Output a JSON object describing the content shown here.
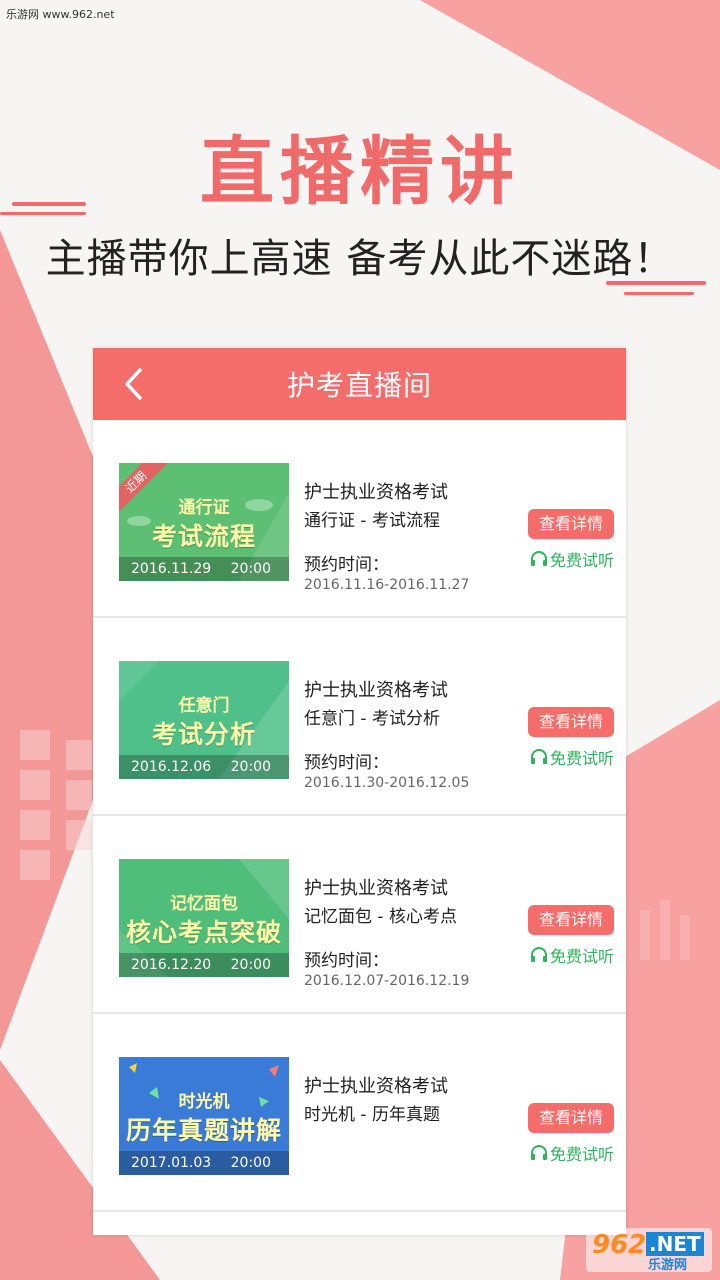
{
  "watermark": "乐游网 www.962.net",
  "headline": "直播精讲",
  "subheadline": "主播带你上高速 备考从此不迷路！",
  "colors": {
    "accent": "#f56d6b",
    "green": "#2fb45b"
  },
  "nav": {
    "back_icon": "chevron-left-icon",
    "title": "护考直播间"
  },
  "courses": [
    {
      "title": "护士执业资格考试",
      "subtitle": "通行证 - 考试流程",
      "reserve_label": "预约时间：",
      "reserve_range": "2016.11.16-2016.11.27",
      "detail_button": "查看详情",
      "free_listen": "免费试听",
      "thumb": {
        "tag": "近期",
        "small": "通行证",
        "big": "考试流程",
        "date": "2016.11.29",
        "time": "20:00",
        "bg": "#5cbf73"
      }
    },
    {
      "title": "护士执业资格考试",
      "subtitle": "任意门 - 考试分析",
      "reserve_label": "预约时间：",
      "reserve_range": "2016.11.30-2016.12.05",
      "detail_button": "查看详情",
      "free_listen": "免费试听",
      "thumb": {
        "tag": "",
        "small": "任意门",
        "big": "考试分析",
        "date": "2016.12.06",
        "time": "20:00",
        "bg": "#4fc08a"
      }
    },
    {
      "title": "护士执业资格考试",
      "subtitle": "记忆面包 - 核心考点",
      "reserve_label": "预约时间：",
      "reserve_range": "2016.12.07-2016.12.19",
      "detail_button": "查看详情",
      "free_listen": "免费试听",
      "thumb": {
        "tag": "",
        "small": "记忆面包",
        "big": "核心考点突破",
        "date": "2016.12.20",
        "time": "20:00",
        "bg": "#4fbe7a"
      }
    },
    {
      "title": "护士执业资格考试",
      "subtitle": "时光机 - 历年真题",
      "reserve_label": "",
      "reserve_range": "",
      "detail_button": "查看详情",
      "free_listen": "免费试听",
      "thumb": {
        "tag": "",
        "small": "时光机",
        "big": "历年真题讲解",
        "date": "2017.01.03",
        "time": "20:00",
        "bg": "#3a7bd8"
      }
    }
  ],
  "logo": {
    "number": "962",
    "site": ".NET",
    "cn": "乐游网"
  }
}
